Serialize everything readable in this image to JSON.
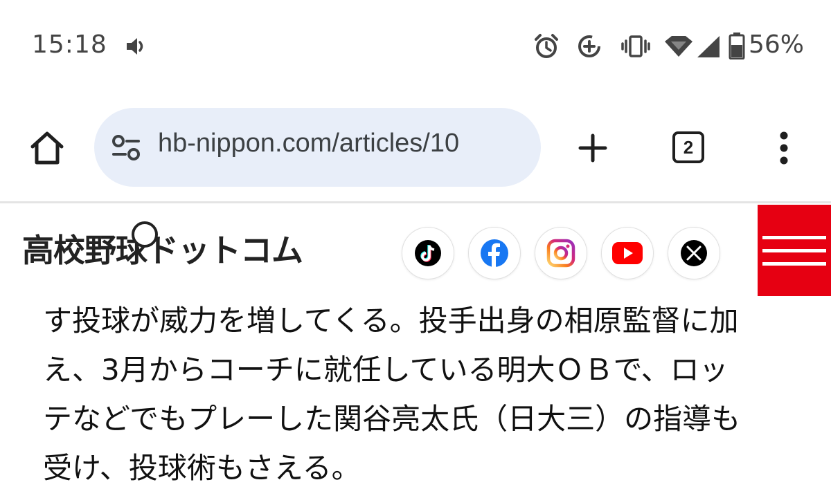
{
  "status_bar": {
    "time": "15:18",
    "battery_percent": "56%",
    "icons": [
      "volume-icon",
      "alarm-icon",
      "data-saver-icon",
      "vibrate-icon",
      "wifi-icon",
      "signal-icon",
      "battery-icon"
    ]
  },
  "browser": {
    "url": "hb-nippon.com/articles/10",
    "tab_count": "2",
    "icons": [
      "home-icon",
      "site-settings-icon",
      "new-tab-icon",
      "tab-switcher-icon",
      "more-menu-icon"
    ]
  },
  "site": {
    "logo_text": "高校野球ドットコム",
    "social": [
      "tiktok-icon",
      "facebook-icon",
      "instagram-icon",
      "youtube-icon",
      "x-icon"
    ],
    "menu_color": "#e60012"
  },
  "article": {
    "lines": [
      "す投球が威力を増してくる。投手出身の相原監督に加",
      "え、3月からコーチに就任している明大ＯＢで、ロッ",
      "テなどでもプレーした関谷亮太氏（日大三）の指導も",
      "受け、投球術もさえる。"
    ]
  }
}
